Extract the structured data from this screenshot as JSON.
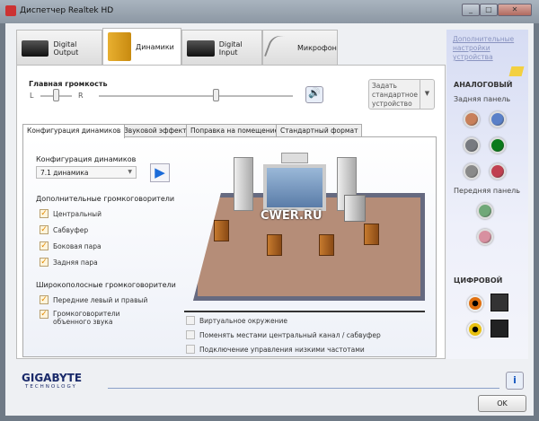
{
  "window": {
    "title": "Диспетчер Realtek HD",
    "minimize": "_",
    "maximize": "□",
    "close": "✕"
  },
  "device_tabs": [
    {
      "label": "Digital Output",
      "icon": "digital-device-icon"
    },
    {
      "label": "Динамики",
      "icon": "speakers-icon",
      "active": true
    },
    {
      "label": "Digital Input",
      "icon": "digital-device-icon"
    },
    {
      "label": "Микрофон",
      "icon": "microphone-icon"
    }
  ],
  "volume": {
    "label": "Главная громкость",
    "left": "L",
    "right": "R",
    "balance": 0.5,
    "level": 0.6
  },
  "default_device": {
    "label": "Задать стандартное устройство"
  },
  "sub_tabs": [
    "Конфигурация динамиков",
    "Звуковой эффект",
    "Поправка на помещение",
    "Стандартный формат"
  ],
  "config": {
    "label": "Конфигурация динамиков",
    "value": "7.1 динамика",
    "extra_label": "Дополнительные громкоговорители",
    "extra": [
      {
        "label": "Центральный",
        "checked": true
      },
      {
        "label": "Сабвуфер",
        "checked": true
      },
      {
        "label": "Боковая пара",
        "checked": true
      },
      {
        "label": "Задняя пара",
        "checked": true
      }
    ],
    "wide_label": "Широкополосные громкоговорители",
    "wide": [
      {
        "label": "Передние левый и правый",
        "checked": true
      },
      {
        "label": "Громкоговорители объенного звука",
        "checked": true
      }
    ],
    "options": [
      {
        "label": "Виртуальное окружение",
        "checked": false
      },
      {
        "label": "Поменять местами центральный канал / сабвуфер",
        "checked": false
      },
      {
        "label": "Подключение управления низкими частотами",
        "checked": false
      }
    ],
    "watermark": "CWER.RU"
  },
  "right_panel": {
    "link": "Дополнительные настройки устройства",
    "analog": "АНАЛОГОВЫЙ",
    "rear": "Задняя панель",
    "front": "Передняя панель",
    "digital": "ЦИФРОВОЙ",
    "rear_jacks": [
      "#c8805a",
      "#5a80c8",
      "#777a80",
      "#0a7a1a",
      "#8a8a8a",
      "#c04050"
    ],
    "front_jacks": [
      "#70a878",
      "#d890a0"
    ]
  },
  "footer": {
    "brand": "GIGABYTE",
    "brand_sub": "TECHNOLOGY",
    "ok": "OK",
    "info": "i"
  }
}
